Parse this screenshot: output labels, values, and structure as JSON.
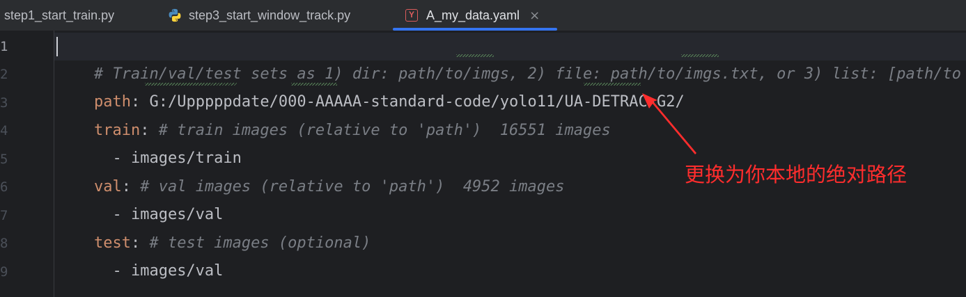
{
  "tabs": [
    {
      "label": "step1_start_train.py",
      "icon": "python-icon",
      "active": false
    },
    {
      "label": "step3_start_window_track.py",
      "icon": "python-icon",
      "active": false
    },
    {
      "label": "A_my_data.yaml",
      "icon": "yaml-icon",
      "active": true
    }
  ],
  "tab_close_symbol": "×",
  "yaml_icon_letter": "Y",
  "editor": {
    "line_numbers": [
      "1",
      "2",
      "3",
      "4",
      "5",
      "6",
      "7",
      "8",
      "9"
    ],
    "current_line": 1,
    "lines": [
      {
        "comment": "# Train/val/test sets as 1) dir: path/to/imgs, 2) file: path/to/imgs.txt, or 3) list: [path/to"
      },
      {
        "key": "path",
        "sep": ": ",
        "value": "G:/Upppppdate/000-AAAAA-standard-code/yolo11/UA-DETRAC-G2/"
      },
      {
        "key": "train",
        "sep": ": ",
        "comment": "# train images (relative to 'path')  16551 images"
      },
      {
        "value": "  - images/train"
      },
      {
        "key": "val",
        "sep": ": ",
        "comment": "# val images (relative to 'path')  4952 images"
      },
      {
        "value": "  - images/val"
      },
      {
        "key": "test",
        "sep": ": ",
        "comment": "# test images (optional)"
      },
      {
        "value": "  - images/val"
      }
    ]
  },
  "annotation": {
    "text": "更换为你本地的绝对路径",
    "color": "#ff2d2d"
  },
  "colors": {
    "background": "#1e1f22",
    "key": "#cf8e6d",
    "comment": "#7a7e85",
    "text": "#bcbec4",
    "active_tab_underline": "#3574f0"
  }
}
